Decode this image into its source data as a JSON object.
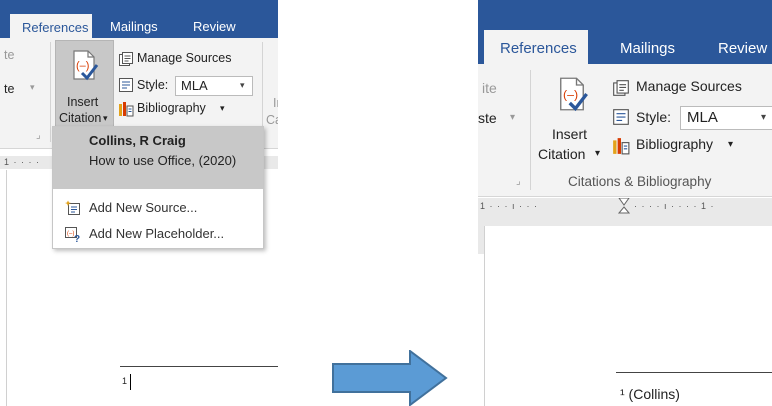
{
  "left": {
    "tabs": [
      {
        "label": "References",
        "active": true
      },
      {
        "label": "Mailings",
        "active": false
      },
      {
        "label": "Review",
        "active": false
      }
    ],
    "partial_left_labels": [
      "te",
      "te",
      "⌄"
    ],
    "insert_citation": {
      "line1": "Insert",
      "line2": "Citation",
      "arrow": "▾"
    },
    "manage_sources": "Manage Sources",
    "style_label": "Style:",
    "style_value": "MLA",
    "bibliography": "Bibliography",
    "bib_arrow": "▾",
    "partial_right": [
      "In",
      "Ca"
    ],
    "dialog_launcher": "⌟",
    "ruler_ticks": "1 · · · ·",
    "dropdown": {
      "citation_author": "Collins, R Craig",
      "citation_title": "How to use Office, (2020)",
      "add_new_source": "Add New Source...",
      "add_new_placeholder": "Add New Placeholder..."
    },
    "footnote_number": "1"
  },
  "right": {
    "tabs": [
      {
        "label": "References",
        "active": true
      },
      {
        "label": "Mailings",
        "active": false
      },
      {
        "label": "Review",
        "active": false
      }
    ],
    "partial_left_labels": [
      "ite",
      "ste"
    ],
    "insert_citation": {
      "line1": "Insert",
      "line2": "Citation",
      "arrow": "▾"
    },
    "manage_sources": "Manage Sources",
    "style_label": "Style:",
    "style_value": "MLA",
    "bibliography": "Bibliography",
    "bib_arrow": "▾",
    "group_label": "Citations & Bibliography",
    "dialog_launcher": "⌟",
    "ruler_ticks": "1 · · · ı · · · ",
    "ruler_ticks2": "· · · · ı · · · · 1 ·",
    "footnote_text": "¹ (Collins)"
  },
  "colors": {
    "accent_blue": "#2b579a",
    "arrow_fill": "#5b9bd5",
    "arrow_stroke": "#41719c"
  }
}
